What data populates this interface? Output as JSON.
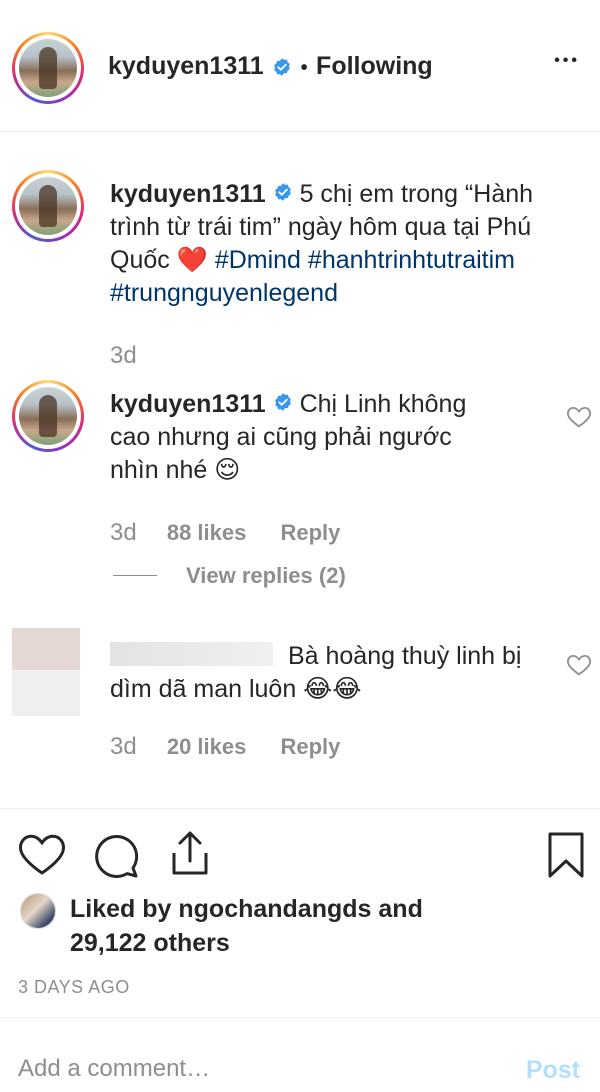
{
  "header": {
    "username": "kyduyen1311",
    "separator": "•",
    "follow_label": "Following",
    "more_label": "•••"
  },
  "caption": {
    "username": "kyduyen1311",
    "text_line1": "5 chị em trong “Hành",
    "text_line2": "trình từ trái tim” ngày hôm qua tại Phú",
    "text_line3_word": "Quốc",
    "emoji": "❤️",
    "hashtag1": "#Dmind",
    "hashtag2": "#hanhtrinhtutraitim",
    "hashtag3": "#trungnguyenlegend",
    "time": "3d"
  },
  "comments": [
    {
      "username": "kyduyen1311",
      "line1": "Chị Linh không",
      "line2": "cao nhưng ai cũng phải ngước",
      "line3": "nhìn nhé",
      "emoji": "😌",
      "time": "3d",
      "likes": "88 likes",
      "reply": "Reply",
      "view_replies": "View replies (2)"
    },
    {
      "line1": "Bà hoàng thuỳ linh bị",
      "line2": "dìm dã man luôn",
      "emoji": "😂😂",
      "time": "3d",
      "likes": "20 likes",
      "reply": "Reply"
    }
  ],
  "likes": {
    "prefix": "Liked by",
    "user": "ngochandangds",
    "and": "and",
    "others": "29,122 others"
  },
  "timestamp": "3 DAYS AGO",
  "comment_input": {
    "placeholder": "Add a comment…",
    "post_label": "Post"
  },
  "colors": {
    "text": "#262626",
    "muted": "#8e8e8e",
    "link": "#003569",
    "verified": "#3897f0",
    "post_disabled": "#b2dffc",
    "divider": "#efefef"
  }
}
